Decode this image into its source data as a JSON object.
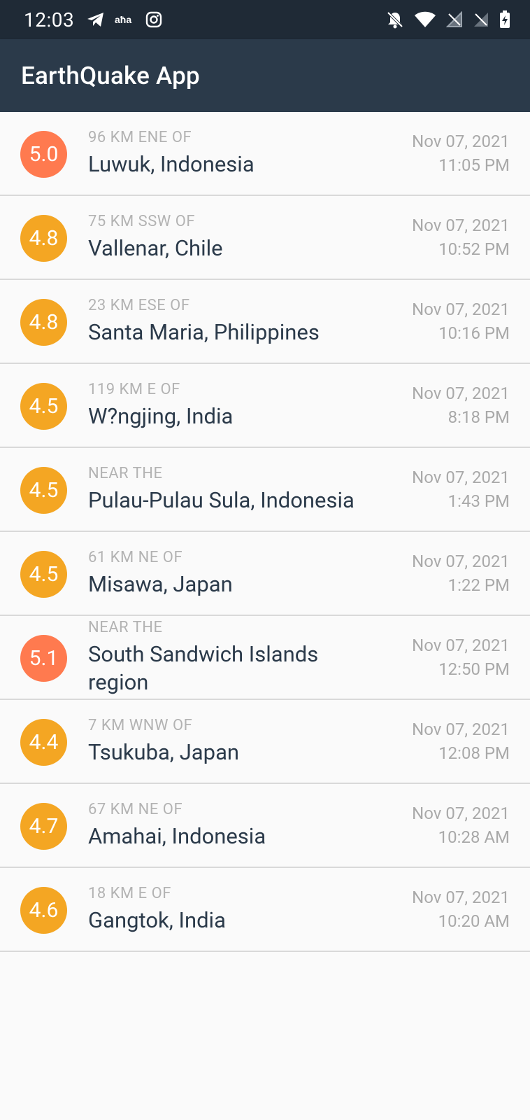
{
  "status_bar": {
    "time": "12:03",
    "left_icons": [
      "telegram-icon",
      "language-icon",
      "instagram-icon"
    ],
    "right_icons": [
      "muted-bell-icon",
      "wifi-icon",
      "no-signal-icon",
      "no-signal-icon",
      "battery-charging-icon"
    ]
  },
  "app_bar": {
    "title": "EarthQuake App"
  },
  "colors": {
    "status_bar": "#1f2a36",
    "app_bar": "#2b3a4a",
    "mag_orange_red": "#ff7a4f",
    "mag_amber": "#f4a623",
    "text_primary": "#2b3a4a",
    "text_secondary": "#b3b3b3"
  },
  "earthquakes": [
    {
      "mag": "5.0",
      "offset": "96 KM ENE OF",
      "location": "Luwuk, Indonesia",
      "date": "Nov 07, 2021",
      "time": "11:05 PM",
      "color": "#ff7a4f"
    },
    {
      "mag": "4.8",
      "offset": "75 KM SSW OF",
      "location": "Vallenar, Chile",
      "date": "Nov 07, 2021",
      "time": "10:52 PM",
      "color": "#f4a623"
    },
    {
      "mag": "4.8",
      "offset": "23 KM ESE OF",
      "location": "Santa Maria, Philippines",
      "date": "Nov 07, 2021",
      "time": "10:16 PM",
      "color": "#f4a623"
    },
    {
      "mag": "4.5",
      "offset": "119 KM E OF",
      "location": "W?ngjing, India",
      "date": "Nov 07, 2021",
      "time": "8:18 PM",
      "color": "#f4a623"
    },
    {
      "mag": "4.5",
      "offset": "NEAR THE",
      "location": "Pulau-Pulau Sula, Indonesia",
      "date": "Nov 07, 2021",
      "time": "1:43 PM",
      "color": "#f4a623"
    },
    {
      "mag": "4.5",
      "offset": "61 KM NE OF",
      "location": "Misawa, Japan",
      "date": "Nov 07, 2021",
      "time": "1:22 PM",
      "color": "#f4a623"
    },
    {
      "mag": "5.1",
      "offset": "NEAR THE",
      "location": "South Sandwich Islands region",
      "date": "Nov 07, 2021",
      "time": "12:50 PM",
      "color": "#ff7a4f"
    },
    {
      "mag": "4.4",
      "offset": "7 KM WNW OF",
      "location": "Tsukuba, Japan",
      "date": "Nov 07, 2021",
      "time": "12:08 PM",
      "color": "#f4a623"
    },
    {
      "mag": "4.7",
      "offset": "67 KM NE OF",
      "location": "Amahai, Indonesia",
      "date": "Nov 07, 2021",
      "time": "10:28 AM",
      "color": "#f4a623"
    },
    {
      "mag": "4.6",
      "offset": "18 KM E OF",
      "location": "Gangtok, India",
      "date": "Nov 07, 2021",
      "time": "10:20 AM",
      "color": "#f4a623"
    }
  ]
}
